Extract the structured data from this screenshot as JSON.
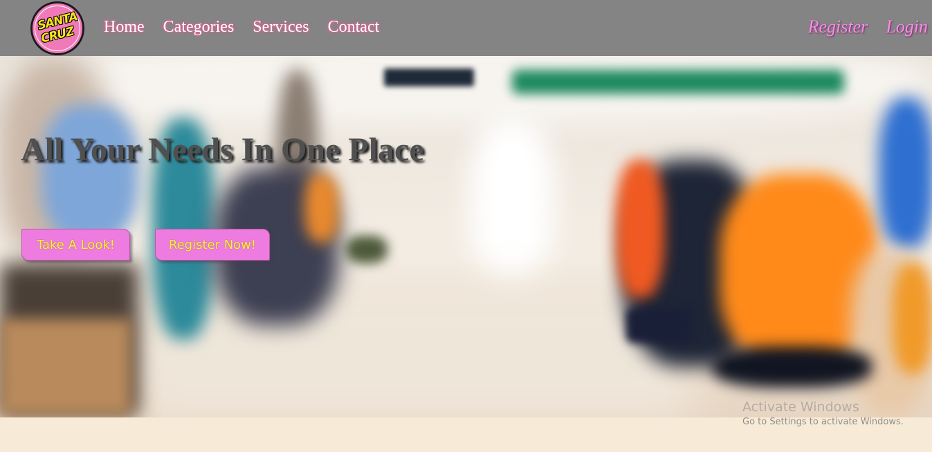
{
  "navbar": {
    "logo": {
      "line1": "SANTA",
      "line2": "CRUZ"
    },
    "links": [
      "Home",
      "Categories",
      "Services",
      "Contact"
    ],
    "auth": {
      "register": "Register",
      "login": "Login"
    }
  },
  "hero": {
    "title": "All Your Needs In One Place",
    "buttons": {
      "take_a_look": "Take A Look!",
      "register_now": "Register Now!"
    }
  },
  "watermark": {
    "title": "Activate Windows",
    "subtitle": "Go to Settings to activate Windows."
  },
  "colors": {
    "navbar_bg": "#848484",
    "cta_bg": "#ee7ce0",
    "cta_text": "#fff23a",
    "auth_text": "#f290e6",
    "page_bg": "#f7ebd8"
  }
}
